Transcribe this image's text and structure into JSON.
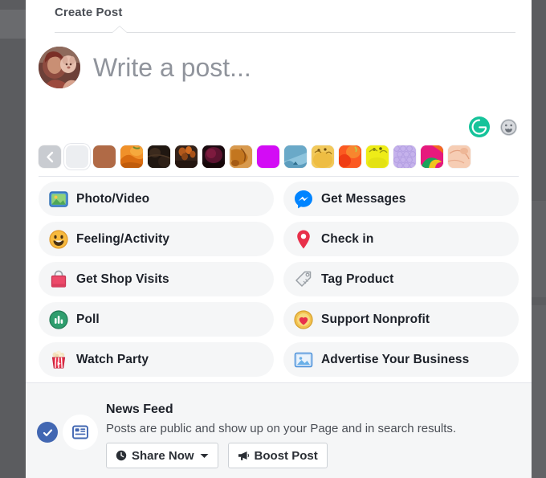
{
  "dialog": {
    "tab_label": "Create Post"
  },
  "composer": {
    "placeholder": "Write a post...",
    "avatar_name": "user-avatar"
  },
  "tools": {
    "grammarly_label": "G",
    "grammarly_color": "#15c39a",
    "emoji_label": "emoji-picker"
  },
  "backgrounds": {
    "nav_label": "previous-backgrounds",
    "swatches": [
      {
        "name": "no-background",
        "type": "plain",
        "color": "#eceef1"
      },
      {
        "name": "solid-brown",
        "type": "solid",
        "color": "#b06a46"
      },
      {
        "name": "pumpkin-photo",
        "type": "image",
        "color": "#e8821f"
      },
      {
        "name": "dark-wood",
        "type": "image",
        "color": "#231a14"
      },
      {
        "name": "acorns-dark",
        "type": "image",
        "color": "#3b2a22"
      },
      {
        "name": "dark-maroon",
        "type": "image",
        "color": "#2a1018"
      },
      {
        "name": "autumn-leaf",
        "type": "image",
        "color": "#c06a20"
      },
      {
        "name": "solid-magenta",
        "type": "solid",
        "color": "#d30cf5"
      },
      {
        "name": "blue-sky",
        "type": "image",
        "color": "#79b6d4"
      },
      {
        "name": "yellow-bird",
        "type": "image",
        "color": "#f0c04c"
      },
      {
        "name": "orange-red",
        "type": "image",
        "color": "#f94f1e"
      },
      {
        "name": "bright-yellow",
        "type": "image",
        "color": "#eeec18"
      },
      {
        "name": "purple-pattern",
        "type": "image",
        "color": "#c2aeea"
      },
      {
        "name": "pink-abstract",
        "type": "image",
        "color": "#e6197d"
      },
      {
        "name": "peach-texture",
        "type": "image",
        "color": "#f4c6ad"
      }
    ]
  },
  "actions": {
    "left": [
      {
        "icon": "photo-video-icon",
        "label": "Photo/Video"
      },
      {
        "icon": "feeling-activity-icon",
        "label": "Feeling/Activity"
      },
      {
        "icon": "shop-visits-icon",
        "label": "Get Shop Visits"
      },
      {
        "icon": "poll-icon",
        "label": "Poll"
      },
      {
        "icon": "watch-party-icon",
        "label": "Watch Party"
      }
    ],
    "right": [
      {
        "icon": "messenger-icon",
        "label": "Get Messages"
      },
      {
        "icon": "check-in-icon",
        "label": "Check in"
      },
      {
        "icon": "tag-product-icon",
        "label": "Tag Product"
      },
      {
        "icon": "support-nonprofit-icon",
        "label": "Support Nonprofit"
      },
      {
        "icon": "advertise-business-icon",
        "label": "Advertise Your Business"
      }
    ]
  },
  "footer": {
    "selected_check": "selected-checkmark",
    "feed_icon": "news-feed-icon",
    "title": "News Feed",
    "description": "Posts are public and show up on your Page and in search results.",
    "share_button": "Share Now",
    "boost_button": "Boost Post",
    "accent_color": "#4267b2"
  }
}
